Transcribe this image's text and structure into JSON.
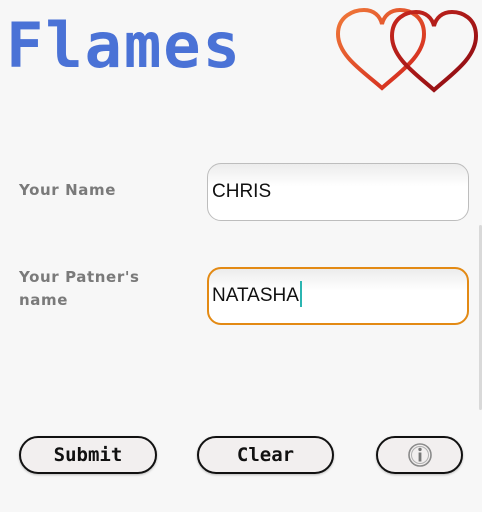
{
  "app": {
    "title": "Flames",
    "logo_icon": "double-heart-icon"
  },
  "form": {
    "name_label": "Your Name",
    "name_value": "CHRIS",
    "partner_label_line1": "Your Patner's",
    "partner_label_line2": "name",
    "partner_value": "NATASHA"
  },
  "buttons": {
    "submit_label": "Submit",
    "clear_label": "Clear",
    "info_icon": "info-icon"
  },
  "colors": {
    "title": "#4a72d6",
    "focus_border": "#e38a14",
    "caret": "#2bb5b1",
    "heart_left": "#e0462a",
    "heart_right": "#b0101a"
  }
}
